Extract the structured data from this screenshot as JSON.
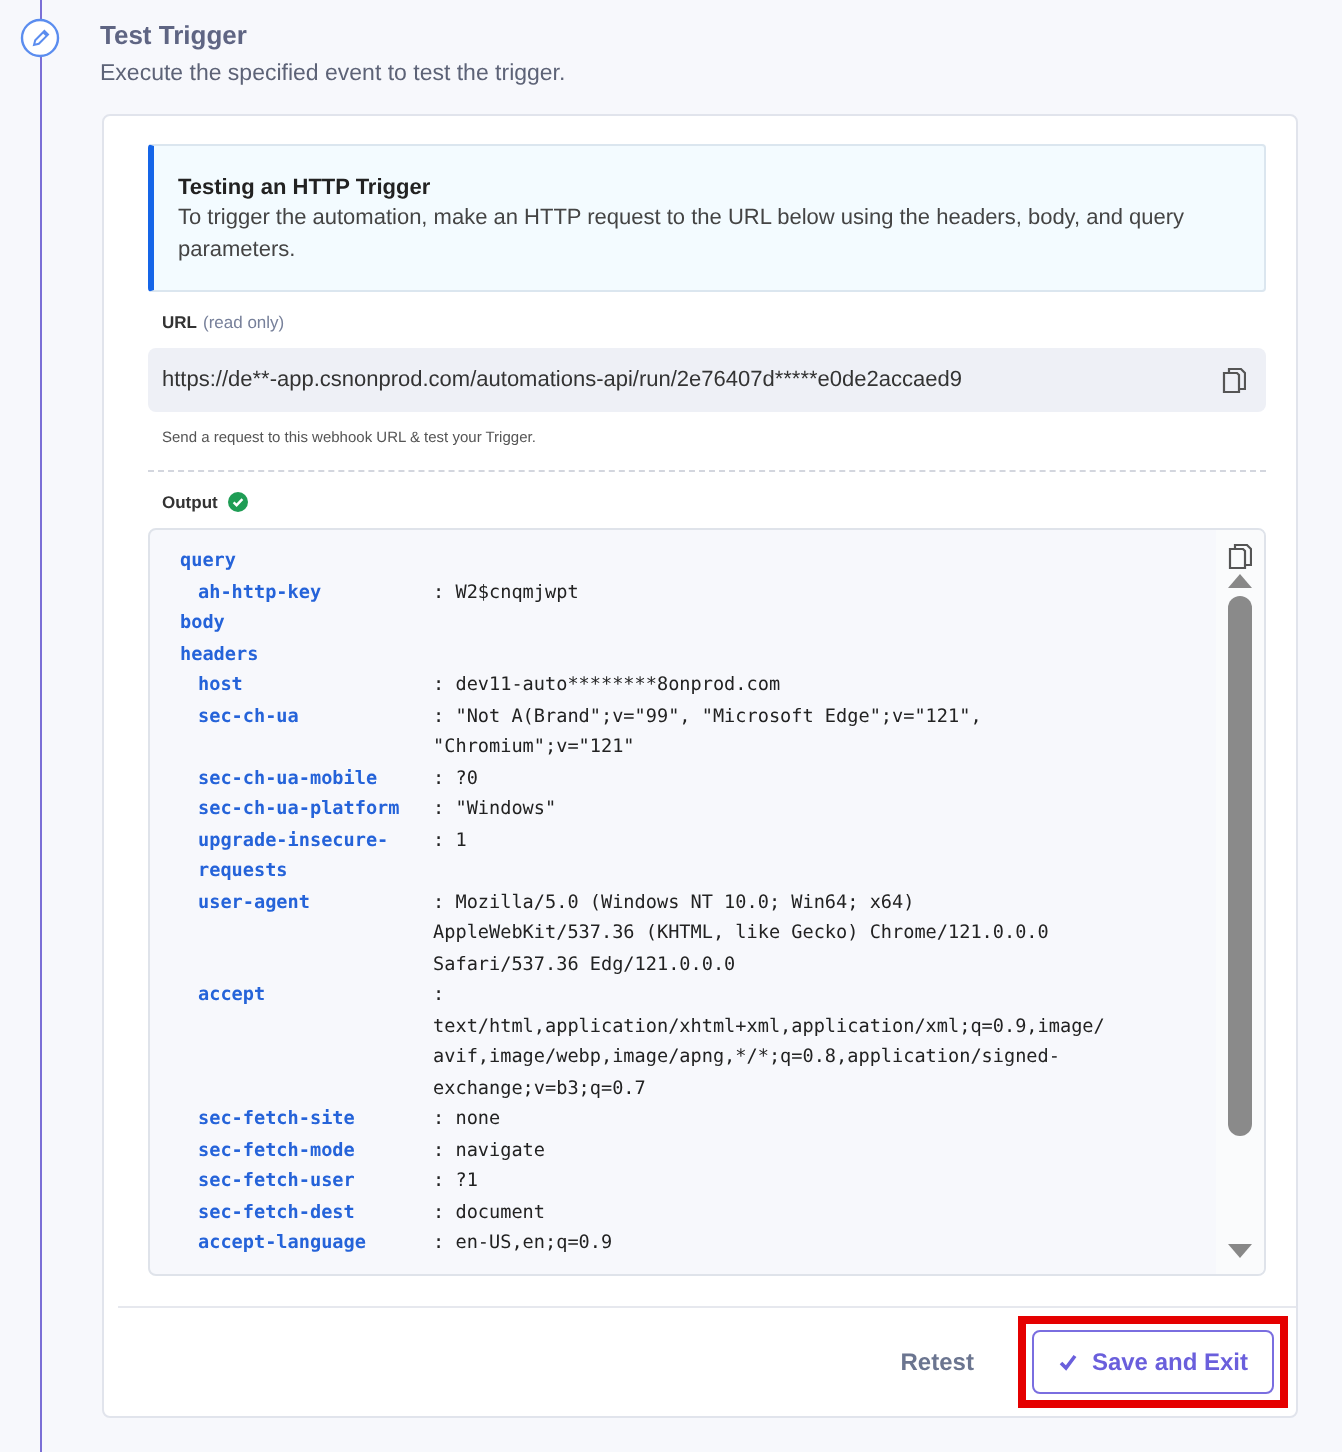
{
  "step": {
    "title": "Test Trigger",
    "description": "Execute the specified event to test the trigger."
  },
  "info": {
    "title": "Testing an HTTP Trigger",
    "text": "To trigger the automation, make an HTTP request to the URL below using the headers, body, and query parameters."
  },
  "url_field": {
    "label": "URL",
    "hint": "(read only)",
    "value": "https://de**-app.csnonprod.com/automations-api/run/2e76407d*****e0de2accaed9",
    "helper": "Send a request to this webhook URL & test your Trigger."
  },
  "output": {
    "label": "Output",
    "success": true,
    "sections": [
      {
        "key": "query",
        "entries": [
          {
            "key": "ah-http-key",
            "value": ": W2$cnqmjwpt"
          }
        ]
      },
      {
        "key": "body"
      },
      {
        "key": "headers",
        "entries": [
          {
            "key": "host",
            "value": ": dev11-auto********8onprod.com"
          },
          {
            "key": "sec-ch-ua",
            "value": ": \"Not A(Brand\";v=\"99\", \"Microsoft Edge\";v=\"121\", \"Chromium\";v=\"121\""
          },
          {
            "key": "sec-ch-ua-mobile",
            "value": ": ?0"
          },
          {
            "key": "sec-ch-ua-platform",
            "value": ": \"Windows\""
          },
          {
            "key": "upgrade-insecure-requests",
            "value": ": 1"
          },
          {
            "key": "user-agent",
            "value": ": Mozilla/5.0 (Windows NT 10.0; Win64; x64) AppleWebKit/537.36 (KHTML, like Gecko) Chrome/121.0.0.0 Safari/537.36 Edg/121.0.0.0"
          },
          {
            "key": "accept",
            "value": ": text/html,application/xhtml+xml,application/xml;q=0.9,image/avif,image/webp,image/apng,*/*;q=0.8,application/signed-exchange;v=b3;q=0.7"
          },
          {
            "key": "sec-fetch-site",
            "value": ": none"
          },
          {
            "key": "sec-fetch-mode",
            "value": ": navigate"
          },
          {
            "key": "sec-fetch-user",
            "value": ": ?1"
          },
          {
            "key": "sec-fetch-dest",
            "value": ": document"
          },
          {
            "key": "accept-language",
            "value": ": en-US,en;q=0.9"
          }
        ]
      }
    ]
  },
  "footer": {
    "buttons": [
      {
        "label": "Retest",
        "kind": "text",
        "highlighted": false
      },
      {
        "label": "Save and Exit",
        "kind": "primary",
        "highlighted": true
      }
    ]
  }
}
